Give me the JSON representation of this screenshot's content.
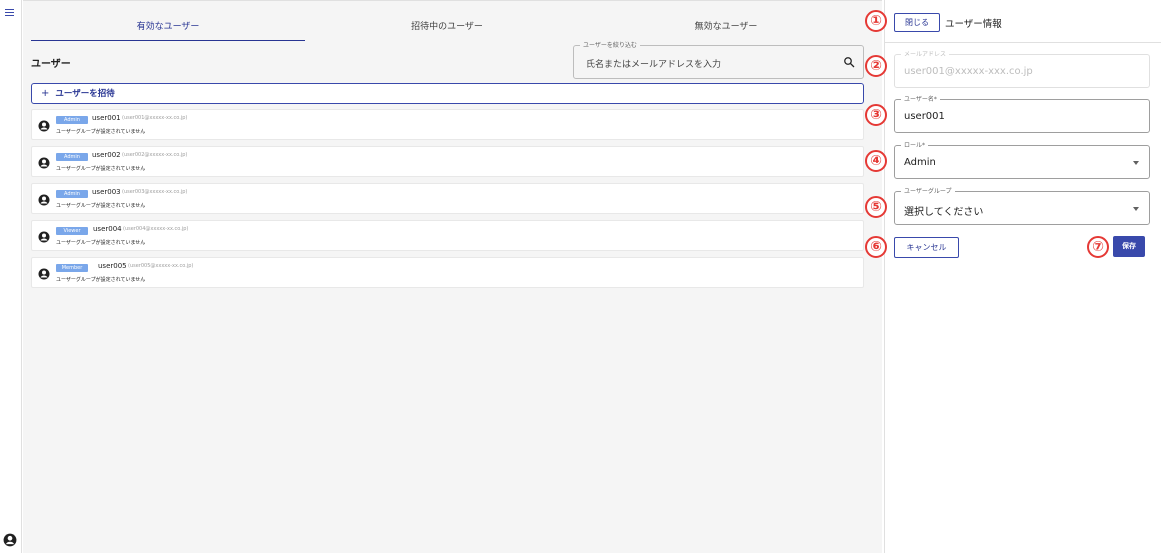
{
  "tabs": [
    {
      "label": "有効なユーザー",
      "active": true
    },
    {
      "label": "招待中のユーザー",
      "active": false
    },
    {
      "label": "無効なユーザー",
      "active": false
    }
  ],
  "users_title": "ユーザー",
  "search": {
    "label": "ユーザーを絞り込む",
    "placeholder": "氏名またはメールアドレスを入力"
  },
  "invite_label": "ユーザーを招待",
  "users": [
    {
      "role": "Admin",
      "name": "user001",
      "email": "(user001@xxxxx-xx.co.jp)",
      "group": "ユーザーグループが設定されていません"
    },
    {
      "role": "Admin",
      "name": "user002",
      "email": "(user002@xxxxx-xx.co.jp)",
      "group": "ユーザーグループが設定されていません"
    },
    {
      "role": "Admin",
      "name": "user003",
      "email": "(user003@xxxxx-xx.co.jp)",
      "group": "ユーザーグループが設定されていません"
    },
    {
      "role": "Viewer",
      "name": "user004",
      "email": "(user004@xxxxx-xx.co.jp)",
      "group": "ユーザーグループが設定されていません"
    },
    {
      "role": "Member",
      "name": "user005",
      "email": "(user005@xxxxx-xx.co.jp)",
      "group": "ユーザーグループが設定されていません"
    }
  ],
  "panel": {
    "close_label": "閉じる",
    "title": "ユーザー情報",
    "email_label": "メールアドレス",
    "email_value": "user001@xxxxx-xxx.co.jp",
    "name_label": "ユーザー名*",
    "name_value": "user001",
    "role_label": "ロール*",
    "role_value": "Admin",
    "group_label": "ユーザーグループ",
    "group_value": "選択してください",
    "cancel_label": "キャンセル",
    "save_label": "保存"
  },
  "markers": [
    "①",
    "②",
    "③",
    "④",
    "⑤",
    "⑥",
    "⑦"
  ],
  "colors": {
    "primary": "#3949ab",
    "badge": "#7aa7ea",
    "marker": "#e53935"
  }
}
